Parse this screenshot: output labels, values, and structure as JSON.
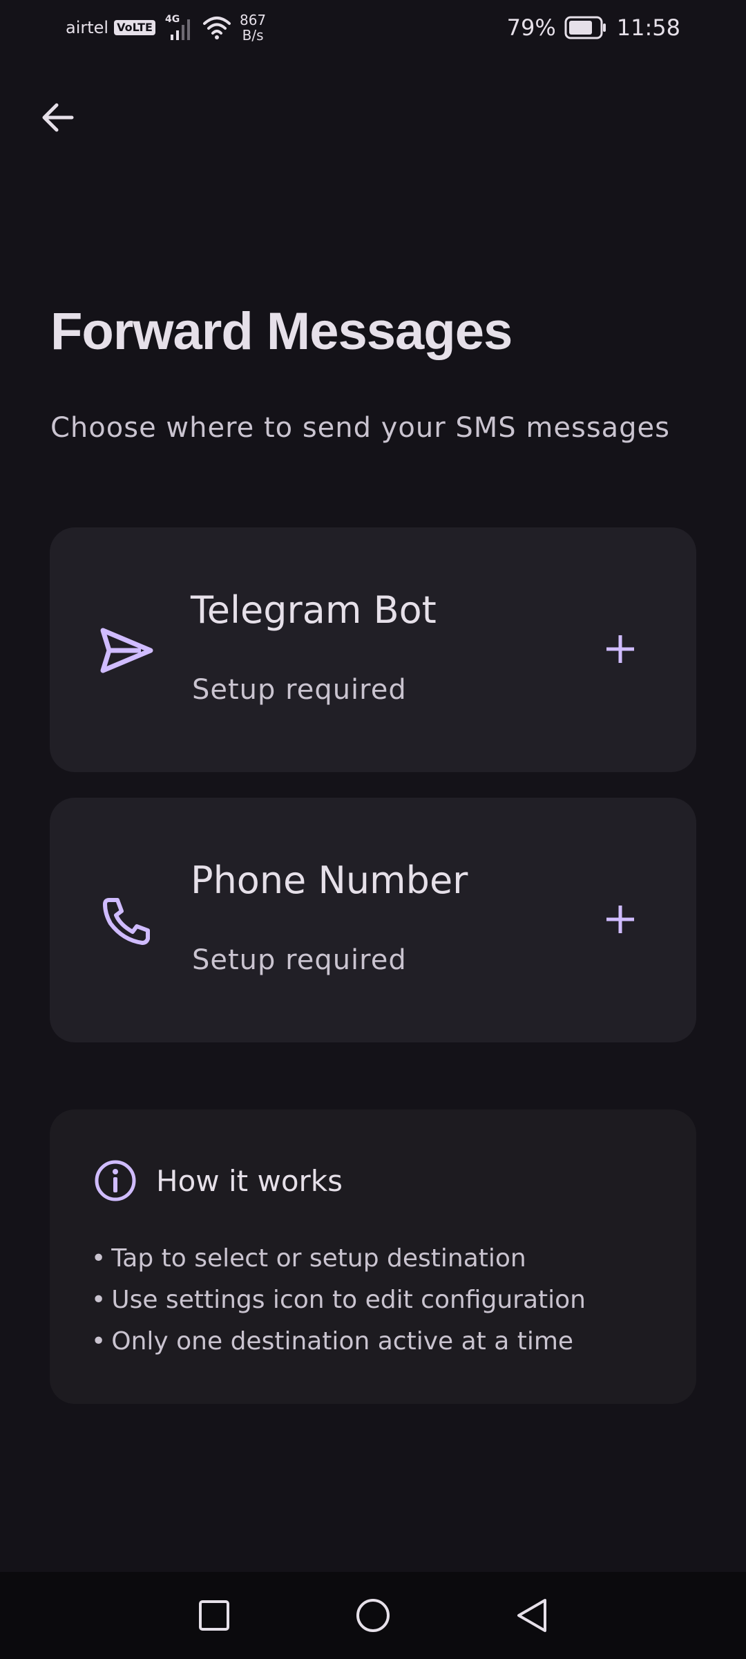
{
  "status_bar": {
    "carrier": "airtel",
    "volte": "VoLTE",
    "network": "4G",
    "speed_value": "867",
    "speed_unit": "B/s",
    "battery_percent": "79%",
    "battery_level": 0.79,
    "time": "11:58"
  },
  "header": {
    "back_icon": "arrow-back-icon"
  },
  "page": {
    "title": "Forward Messages",
    "subtitle": "Choose where to send your SMS messages"
  },
  "destinations": [
    {
      "title": "Telegram Bot",
      "status": "Setup required",
      "icon": "send-icon",
      "action_icon": "add-icon"
    },
    {
      "title": "Phone Number",
      "status": "Setup required",
      "icon": "phone-icon",
      "action_icon": "add-icon"
    }
  ],
  "info": {
    "icon": "info-icon",
    "title": "How it works",
    "bullet": "•",
    "items": [
      "Tap to select or setup destination",
      "Use settings icon to edit configuration",
      "Only one destination active at a time"
    ]
  },
  "nav_bar": {
    "recents_icon": "square-recents-icon",
    "home_icon": "circle-home-icon",
    "back_icon": "triangle-back-icon"
  },
  "colors": {
    "background": "#141218",
    "card": "#211f26",
    "info_card": "#1d1b20",
    "accent": "#d0bcff",
    "text_primary": "#e6e0e9",
    "text_secondary": "#cac4d0",
    "nav_bar": "#0b0a0d"
  }
}
